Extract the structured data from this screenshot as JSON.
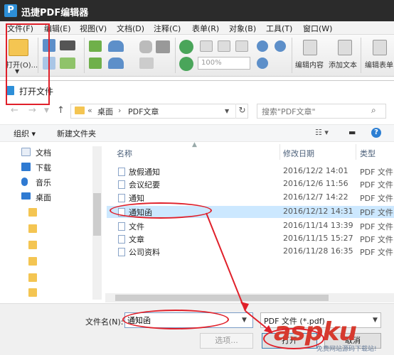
{
  "app": {
    "title": "迅捷PDF编辑器",
    "logo_letter": "P"
  },
  "menu": [
    "文件(F)",
    "编辑(E)",
    "视图(V)",
    "文档(D)",
    "注释(C)",
    "表单(R)",
    "对象(B)",
    "工具(T)",
    "窗口(W)"
  ],
  "ribbon": {
    "open_label": "打开(O)...",
    "zoom_value": "100%",
    "edit_content_label": "编辑内容",
    "add_text_label": "添加文本",
    "edit_form_label": "编辑表单"
  },
  "dialog": {
    "title": "打开文件",
    "breadcrumb": {
      "sep": "«",
      "item1": "桌面",
      "arrow": "›",
      "item2": "PDF文章"
    },
    "search_placeholder": "搜索\"PDF文章\"",
    "organize": "组织 ▾",
    "new_folder": "新建文件夹",
    "nav_items": [
      {
        "label": "文档",
        "icon": "documents-icon"
      },
      {
        "label": "下载",
        "icon": "download-icon"
      },
      {
        "label": "音乐",
        "icon": "music-icon"
      },
      {
        "label": "桌面",
        "icon": "desktop-icon"
      }
    ],
    "columns": {
      "name": "名称",
      "date": "修改日期",
      "type": "类型"
    },
    "files": [
      {
        "name": "放假通知",
        "date": "2016/12/2 14:01",
        "type": "PDF 文件"
      },
      {
        "name": "会议纪要",
        "date": "2016/12/6 11:56",
        "type": "PDF 文件"
      },
      {
        "name": "通知",
        "date": "2016/12/7 14:22",
        "type": "PDF 文件"
      },
      {
        "name": "通知函",
        "date": "2016/12/12 14:31",
        "type": "PDF 文件"
      },
      {
        "name": "文件",
        "date": "2016/11/14 13:39",
        "type": "PDF 文件"
      },
      {
        "name": "文章",
        "date": "2016/11/15 15:27",
        "type": "PDF 文件"
      },
      {
        "name": "公司资料",
        "date": "2016/11/28 16:35",
        "type": "PDF 文件"
      }
    ],
    "selected_index": 3,
    "filename_label": "文件名(N):",
    "filename_value": "通知函",
    "filetype_value": "PDF 文件 (*.pdf)",
    "options_button": "选项...",
    "open_button": "打开",
    "cancel_button": "取消"
  },
  "watermark": {
    "main": "aspku",
    "sub": "免费网站源码下载站!"
  },
  "colors": {
    "annotation": "#e0202a",
    "selection": "#cce8ff",
    "titlebar": "#2b2b2b",
    "accent": "#2d8fd8"
  }
}
